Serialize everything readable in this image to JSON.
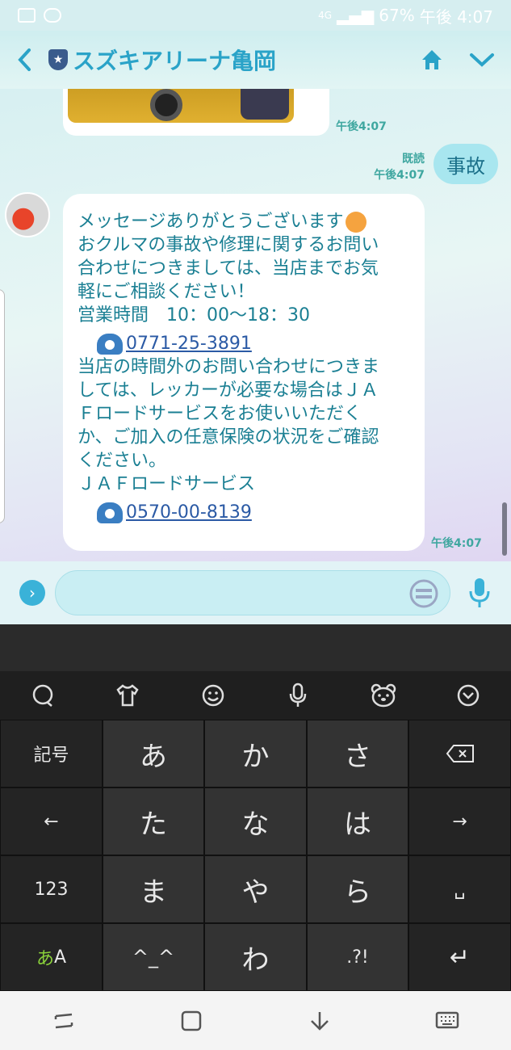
{
  "status_bar": {
    "network": "4G",
    "battery": "67%",
    "time": "午後 4:07"
  },
  "header": {
    "title": "スズキアリーナ亀岡",
    "back_icon": "chevron-left-icon",
    "home_icon": "home-icon",
    "menu_icon": "chevron-down-icon"
  },
  "chat": {
    "image_message_time": "午後4:07",
    "my_message": {
      "read_label": "既読",
      "time": "午後4:07",
      "text": "事故"
    },
    "reply": {
      "line1": "メッセージありがとうございます",
      "body": "おクルマの事故や修理に関するお問い\n合わせにつきましては、当店までお気\n軽にご相談ください！\n営業時間　10：00〜18：30",
      "phone1": "0771-25-3891",
      "body2": "当店の時間外のお問い合わせにつきま\nしては、レッカーが必要な場合はＪＡ\nＦロードサービスをお使いいただく\nか、ご加入の任意保険の状況をご確認\nください。\nＪＡＦロードサービス",
      "phone2": "0570-00-8139",
      "time": "午後4:07"
    }
  },
  "input_bar": {
    "placeholder": "",
    "value": ""
  },
  "keyboard": {
    "toolbar_icons": [
      "chat-icon",
      "shirt-icon",
      "smiley-icon",
      "mic-icon",
      "bear-icon",
      "chevron-down-icon"
    ],
    "keys": {
      "kigou": "記号",
      "a": "あ",
      "ka": "か",
      "sa": "さ",
      "backspace": "⌫",
      "left": "←",
      "ta": "た",
      "na": "な",
      "ha": "は",
      "right": "→",
      "num": "123",
      "ma": "ま",
      "ya": "や",
      "ra": "ら",
      "space": "␣",
      "lang_a": "あ",
      "lang_A": "A",
      "face": "^_^",
      "wa": "わ",
      "punct": ".?!",
      "enter": "↵"
    }
  },
  "colors": {
    "accent": "#2aa3c8",
    "bubble_text": "#1a7f93",
    "my_bubble": "#a8e6ef"
  }
}
